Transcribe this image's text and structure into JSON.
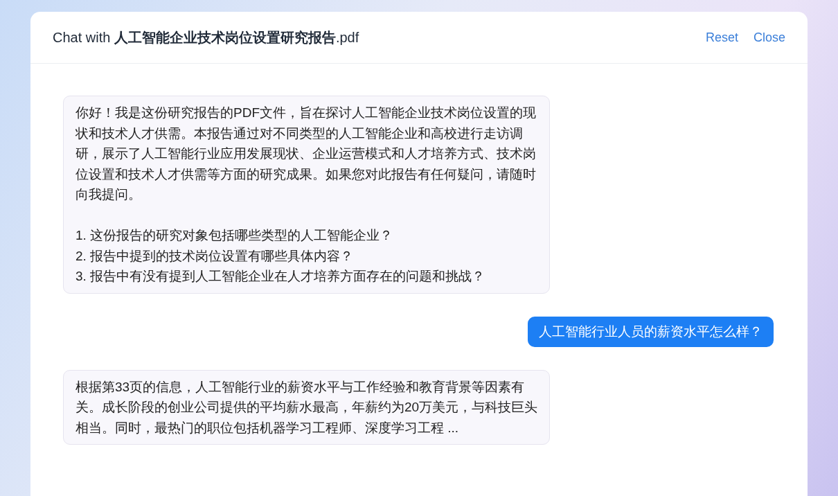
{
  "header": {
    "title": "Chat with **人工智能企业技术岗位设置研究报告**.pdf",
    "actions": [
      "Reset",
      "Close"
    ]
  },
  "messages": [
    {
      "kind": "assistant",
      "text": "你好！我是这份研究报告的PDF文件，旨在探讨人工智能企业技术岗位设置的现状和技术人才供需。本报告通过对不同类型的人工智能企业和高校进行走访调研，展示了人工智能行业应用发展现状、企业运营模式和人才培养方式、技术岗位设置和技术人才供需等方面的研究成果。如果您对此报告有任何疑问，请随时向我提问。",
      "questions": [
        "1. 这份报告的研究对象包括哪些类型的人工智能企业？",
        "2. 报告中提到的技术岗位设置有哪些具体内容？",
        "3. 报告中有没有提到人工智能企业在人才培养方面存在的问题和挑战？"
      ]
    },
    {
      "kind": "user",
      "text": "人工智能行业人员的薪资水平怎么样？"
    },
    {
      "kind": "assistant",
      "text": "根据第33页的信息，人工智能行业的薪资水平与工作经验和教育背景等因素有关。成长阶段的创业公司提供的平均薪水最高，年薪约为20万美元，与科技巨头相当。同时，最热门的职位包括机器学习工程师、深度学习工程 ..."
    }
  ]
}
